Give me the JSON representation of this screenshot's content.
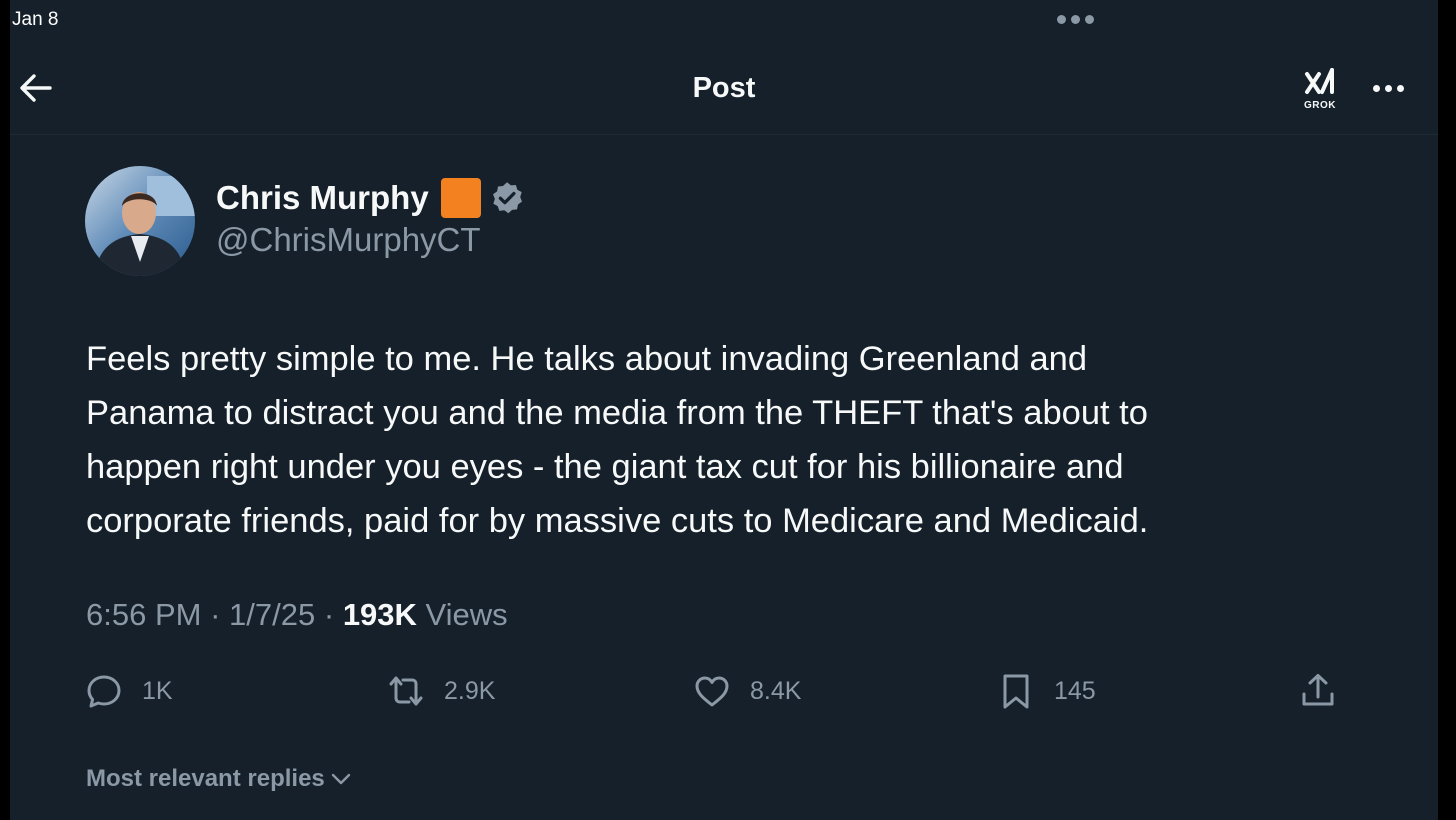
{
  "status_bar": {
    "date": "Jan 8"
  },
  "header": {
    "title": "Post",
    "grok_label": "GROK"
  },
  "author": {
    "display_name": "Chris Murphy",
    "handle": "@ChrisMurphyCT",
    "badge_color": "#f48120",
    "verified_color": "#8b98a5"
  },
  "tweet": {
    "text_lines": [
      "Feels pretty simple to me. He talks about invading Greenland and",
      "Panama to distract you and the media from the THEFT that's about to",
      "happen right under you eyes - the giant tax cut for his billionaire and",
      "corporate friends, paid for by massive cuts to Medicare and Medicaid."
    ],
    "time": "6:56 PM",
    "date": "1/7/25",
    "separator": "·",
    "views_count": "193K",
    "views_label": "Views"
  },
  "actions": {
    "replies": "1K",
    "reposts": "2.9K",
    "likes": "8.4K",
    "bookmarks": "145"
  },
  "replies_sort": {
    "label": "Most relevant replies"
  },
  "colors": {
    "background": "#15202b",
    "text_primary": "#f7f9f9",
    "text_secondary": "#8b98a5"
  }
}
